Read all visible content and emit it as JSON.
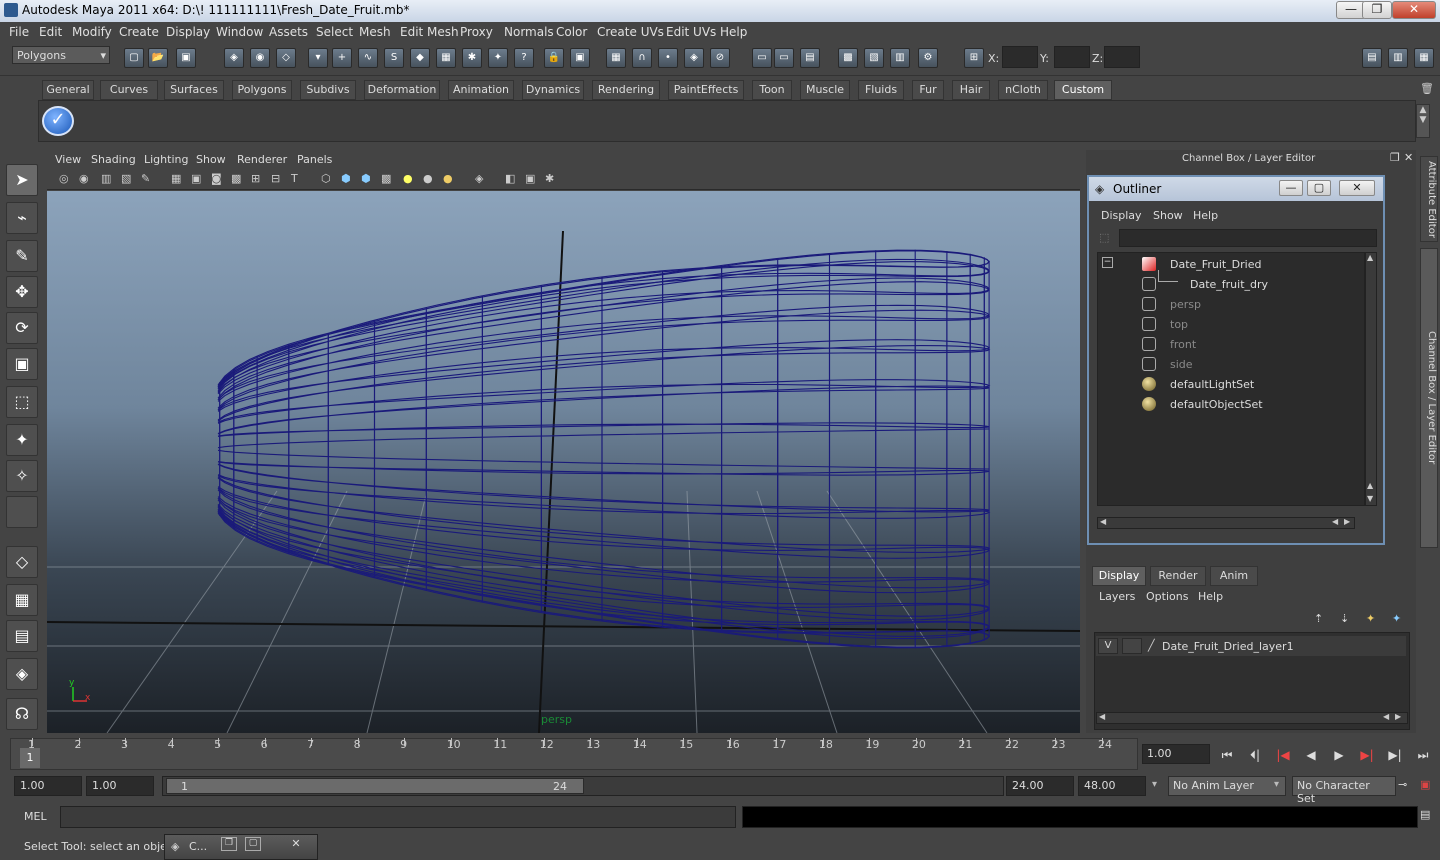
{
  "window": {
    "title": "Autodesk Maya 2011 x64: D:\\! 111111111\\Fresh_Date_Fruit.mb*",
    "minimize": "—",
    "maximize": "❐",
    "close": "✕"
  },
  "menubar": [
    "File",
    "Edit",
    "Modify",
    "Create",
    "Display",
    "Window",
    "Assets",
    "Select",
    "Mesh",
    "Edit Mesh",
    "Proxy",
    "Normals",
    "Color",
    "Create UVs",
    "Edit UVs",
    "Help"
  ],
  "statusline": {
    "mode": "Polygons",
    "x_label": "X:",
    "y_label": "Y:",
    "z_label": "Z:"
  },
  "shelf": {
    "tabs": [
      "General",
      "Curves",
      "Surfaces",
      "Polygons",
      "Subdivs",
      "Deformation",
      "Animation",
      "Dynamics",
      "Rendering",
      "PaintEffects",
      "Toon",
      "Muscle",
      "Fluids",
      "Fur",
      "Hair",
      "nCloth",
      "Custom"
    ],
    "active_tab": "Custom"
  },
  "panel": {
    "menus": [
      "View",
      "Shading",
      "Lighting",
      "Show",
      "Renderer",
      "Panels"
    ],
    "camera": "persp"
  },
  "rightpanel": {
    "header": "Channel Box / Layer Editor",
    "vertical_tabs": [
      "Attribute Editor",
      "Channel Box / Layer Editor"
    ]
  },
  "outliner": {
    "title": "Outliner",
    "menus": [
      "Display",
      "Show",
      "Help"
    ],
    "items": [
      {
        "label": "Date_Fruit_Dried",
        "indent": 0,
        "dim": false,
        "icon": "mesh-icon"
      },
      {
        "label": "Date_fruit_dry",
        "indent": 1,
        "dim": false,
        "icon": "mesh-icon"
      },
      {
        "label": "persp",
        "indent": 0,
        "dim": true,
        "icon": "camera-icon"
      },
      {
        "label": "top",
        "indent": 0,
        "dim": true,
        "icon": "camera-icon"
      },
      {
        "label": "front",
        "indent": 0,
        "dim": true,
        "icon": "camera-icon"
      },
      {
        "label": "side",
        "indent": 0,
        "dim": true,
        "icon": "camera-icon"
      },
      {
        "label": "defaultLightSet",
        "indent": 0,
        "dim": false,
        "icon": "set-icon"
      },
      {
        "label": "defaultObjectSet",
        "indent": 0,
        "dim": false,
        "icon": "set-icon"
      }
    ]
  },
  "layereditor": {
    "tabs": [
      "Display",
      "Render",
      "Anim"
    ],
    "active_tab": "Display",
    "menus": [
      "Layers",
      "Options",
      "Help"
    ],
    "layers": [
      {
        "visible": "V",
        "name": "Date_Fruit_Dried_layer1"
      }
    ]
  },
  "timeslider": {
    "ticks": [
      1,
      2,
      3,
      4,
      5,
      6,
      7,
      8,
      9,
      10,
      11,
      12,
      13,
      14,
      15,
      16,
      17,
      18,
      19,
      20,
      21,
      22,
      23,
      24
    ],
    "current_frame_marker": "1",
    "current_frame": "1.00"
  },
  "rangeslider": {
    "start": "1.00",
    "playback_start": "1.00",
    "range_start": "1",
    "range_end": "24",
    "playback_end": "24.00",
    "end": "48.00",
    "anim_layer": "No Anim Layer",
    "character_set": "No Character Set"
  },
  "commandline": {
    "label": "MEL"
  },
  "helpline": {
    "text": "Select Tool: select an object",
    "taskbar_label": "C..."
  }
}
